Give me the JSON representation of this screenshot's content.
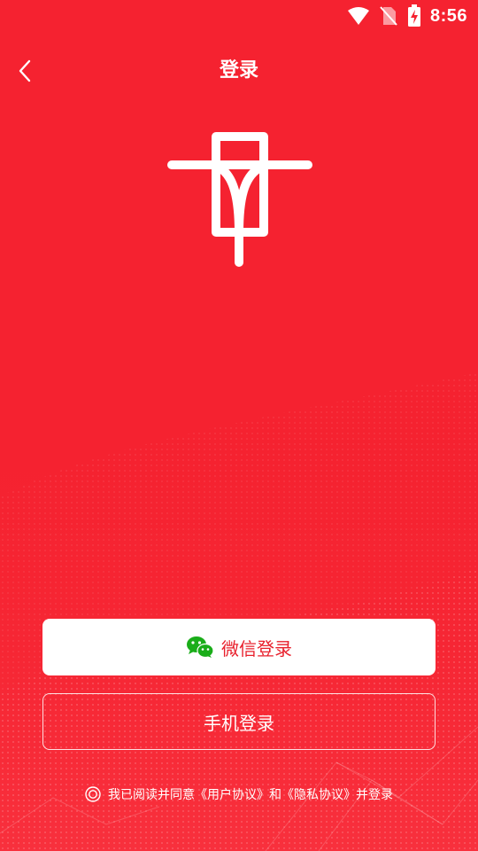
{
  "status_bar": {
    "time": "8:56",
    "icons": [
      "wifi-icon",
      "no-sim-icon",
      "battery-charging-icon"
    ]
  },
  "nav": {
    "title": "登录",
    "back_icon": "chevron-left-icon"
  },
  "logo": {
    "icon": "app-logo"
  },
  "buttons": {
    "wechat_login": {
      "label": "微信登录",
      "icon": "wechat-icon"
    },
    "phone_login": {
      "label": "手机登录"
    }
  },
  "agreement": {
    "prefix": "我已阅读并同意",
    "user_agreement": "《用户协议》",
    "conjunction": "和",
    "privacy_policy": "《隐私协议》",
    "suffix": "并登录"
  },
  "colors": {
    "background": "#f52230",
    "button_text_red": "#e8202c",
    "wechat_green": "#1aad19",
    "white": "#ffffff"
  }
}
